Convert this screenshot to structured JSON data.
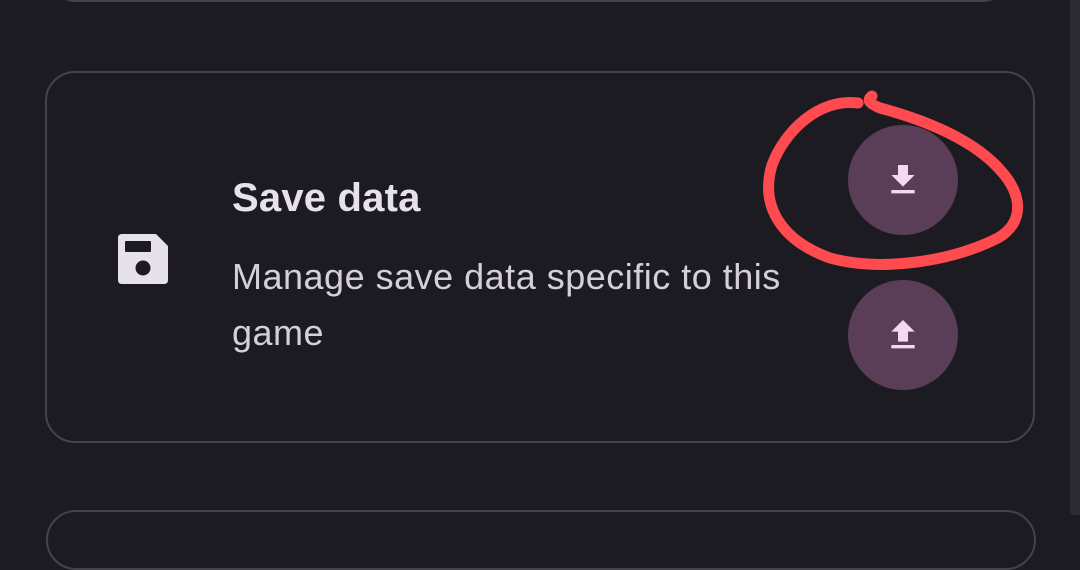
{
  "save_data_card": {
    "title": "Save data",
    "description": "Manage save data specific to this game",
    "icon": "save-icon",
    "actions": [
      {
        "name": "export",
        "icon": "download-icon"
      },
      {
        "name": "import",
        "icon": "upload-icon"
      }
    ]
  },
  "colors": {
    "background": "#1d1b22",
    "card_border": "#45424d",
    "title_text": "#e7e1ea",
    "body_text": "#d5cfd9",
    "button_fill": "#5a3e58",
    "icon_fill": "#f4d8f2",
    "annotation": "#ff4a4f"
  }
}
